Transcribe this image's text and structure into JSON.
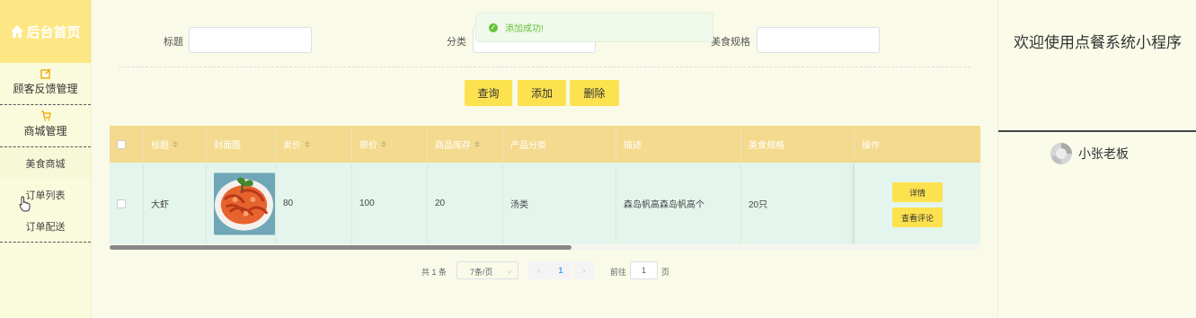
{
  "sidebar": {
    "home_label": "后台首页",
    "groups": [
      {
        "label": "顾客反馈管理"
      },
      {
        "label": "商城管理"
      }
    ],
    "sub_items": [
      {
        "label": "美食商城"
      },
      {
        "label": "订单列表"
      },
      {
        "label": "订单配送"
      }
    ]
  },
  "search": {
    "title_label": "标题",
    "title_value": "",
    "category_label": "分类",
    "category_value": "",
    "spec_label": "美食规格",
    "spec_value": ""
  },
  "toast": {
    "message": "添加成功!"
  },
  "actions": {
    "query": "查询",
    "add": "添加",
    "delete": "删除"
  },
  "table": {
    "columns": [
      "标题",
      "封面图",
      "卖价",
      "原价",
      "商品库存",
      "产品分类",
      "描述",
      "美食规格",
      "操作"
    ],
    "rows": [
      {
        "title": "大虾",
        "price": "80",
        "original_price": "100",
        "stock": "20",
        "category": "汤类",
        "description": "森岛帆高森岛帆高个",
        "spec": "20只",
        "detail_label": "详情",
        "comment_label": "查看评论"
      }
    ],
    "scroll_fraction": 0.53
  },
  "pagination": {
    "total_text": "共 1 条",
    "page_size": "7条/页",
    "current_page": "1",
    "goto_label": "前往",
    "goto_value": "1",
    "page_suffix": "页"
  },
  "right_panel": {
    "welcome": "欢迎使用点餐系统小程序",
    "username": "小张老板"
  },
  "colors": {
    "accent": "#fde24f",
    "header_bg": "#f4da8e",
    "row_bg": "#e3f5ec",
    "home_bg": "#fde784",
    "success": "#67c23a"
  }
}
